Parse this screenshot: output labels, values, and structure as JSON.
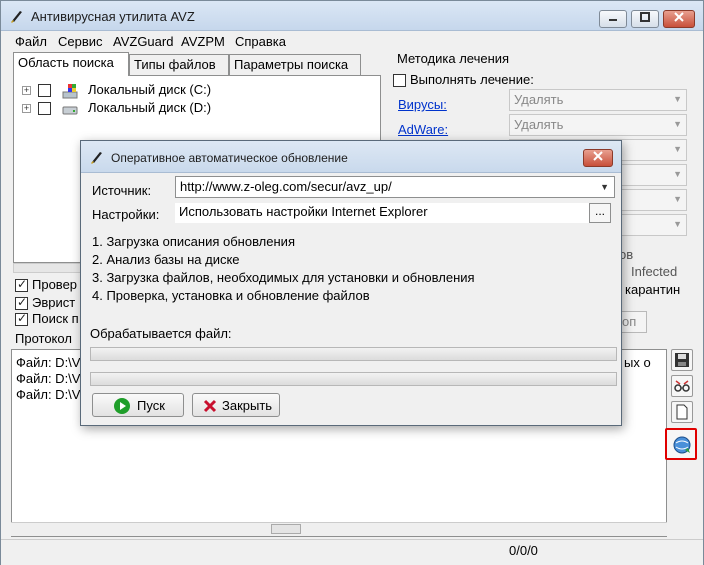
{
  "window": {
    "title": "Антивирусная утилита AVZ"
  },
  "menu": [
    "Файл",
    "Сервис",
    "AVZGuard",
    "AVZPM",
    "Справка"
  ],
  "tabs": [
    "Область поиска",
    "Типы файлов",
    "Параметры поиска"
  ],
  "tree": [
    {
      "label": "Локальный диск (C:)"
    },
    {
      "label": "Локальный диск (D:)"
    }
  ],
  "options": [
    "Провер",
    "Эврист",
    "Поиск п"
  ],
  "method": {
    "title": "Методика лечения",
    "perform_label": "Выполнять лечение:",
    "rows": [
      {
        "label": "Вирусы:",
        "value": "Удалять"
      },
      {
        "label": "AdWare:",
        "value": "Удалять"
      }
    ],
    "partial_texts": [
      "ов",
      "Infected",
      "карантин",
      "оп"
    ]
  },
  "log": {
    "label": "Протокол",
    "lines": [
      "Файл: D:\\V",
      "Файл: D:\\V",
      "Файл: D:\\V"
    ],
    "partial_right": "ых о"
  },
  "status": {
    "text": "0/0/0"
  },
  "dialog": {
    "title": "Оперативное автоматическое обновление",
    "source_label": "Источник:",
    "source_value": "http://www.z-oleg.com/secur/avz_up/",
    "settings_label": "Настройки:",
    "settings_value": "Использовать настройки Internet Explorer",
    "settings_button": "...",
    "steps": [
      "1. Загрузка описания обновления",
      "2. Анализ базы на диске",
      "3. Загрузка файлов, необходимых для установки и обновления",
      "4. Проверка, установка и обновление файлов"
    ],
    "processing_label": "Обрабатывается файл:",
    "progress": [
      0,
      0
    ],
    "start_button": "Пуск",
    "close_button": "Закрыть"
  },
  "colors": {
    "accent_red": "#e00000",
    "link_blue": "#0033cc",
    "go_green": "#1f9e2a",
    "close_red": "#c8102e"
  }
}
